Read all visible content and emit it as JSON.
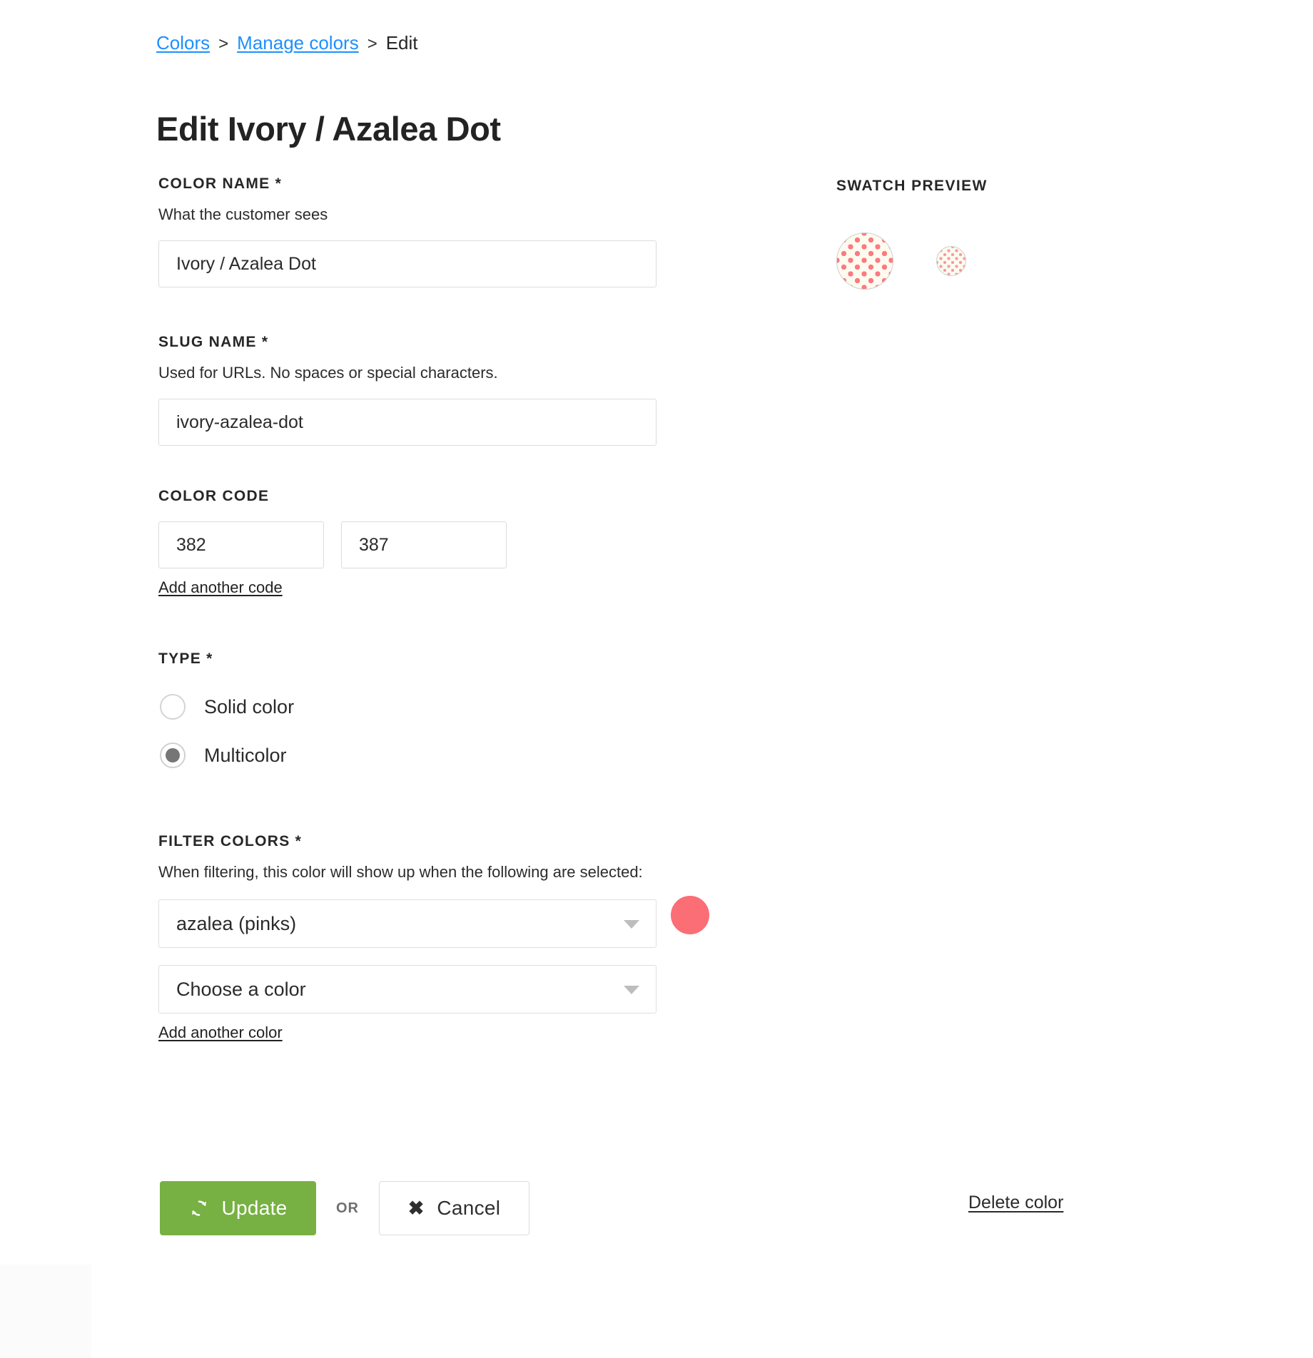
{
  "breadcrumb": {
    "items": [
      {
        "label": "Colors",
        "link": true
      },
      {
        "label": "Manage colors",
        "link": true
      },
      {
        "label": "Edit",
        "link": false
      }
    ],
    "separator": ">"
  },
  "page_title": "Edit Ivory / Azalea Dot",
  "form": {
    "color_name": {
      "label": "COLOR NAME *",
      "help": "What the customer sees",
      "value": "Ivory / Azalea Dot"
    },
    "slug_name": {
      "label": "SLUG NAME *",
      "help": "Used for URLs. No spaces or special characters.",
      "value": "ivory-azalea-dot"
    },
    "color_code": {
      "label": "COLOR CODE",
      "values": [
        "382",
        "387"
      ],
      "add_link": "Add another code"
    },
    "type": {
      "label": "TYPE *",
      "options": [
        {
          "label": "Solid color",
          "selected": false
        },
        {
          "label": "Multicolor",
          "selected": true
        }
      ]
    },
    "filter_colors": {
      "label": "FILTER COLORS *",
      "help": "When filtering, this color will show up when the following are selected:",
      "selects": [
        {
          "value": "azalea (pinks)",
          "swatch": "#fb6e76"
        },
        {
          "value": "Choose a color",
          "swatch": null
        }
      ],
      "add_link": "Add another color"
    }
  },
  "actions": {
    "update_label": "Update",
    "update_icon": "refresh-icon",
    "or_label": "OR",
    "cancel_label": "Cancel",
    "cancel_icon": "close-x-icon",
    "delete_label": "Delete color"
  },
  "preview": {
    "title": "SWATCH PREVIEW",
    "swatches": [
      {
        "name": "large-swatch",
        "base": "#fdfaef",
        "dot": "#fb7a80"
      },
      {
        "name": "small-swatch",
        "base": "#fdfaef",
        "dot": "#f89aa0"
      }
    ]
  },
  "colors": {
    "link": "#1e8fff",
    "accent_green": "#77b043",
    "filter_pink": "#fb6e76",
    "swatch_base": "#fdfaef",
    "swatch_dot": "#fb7a80"
  }
}
